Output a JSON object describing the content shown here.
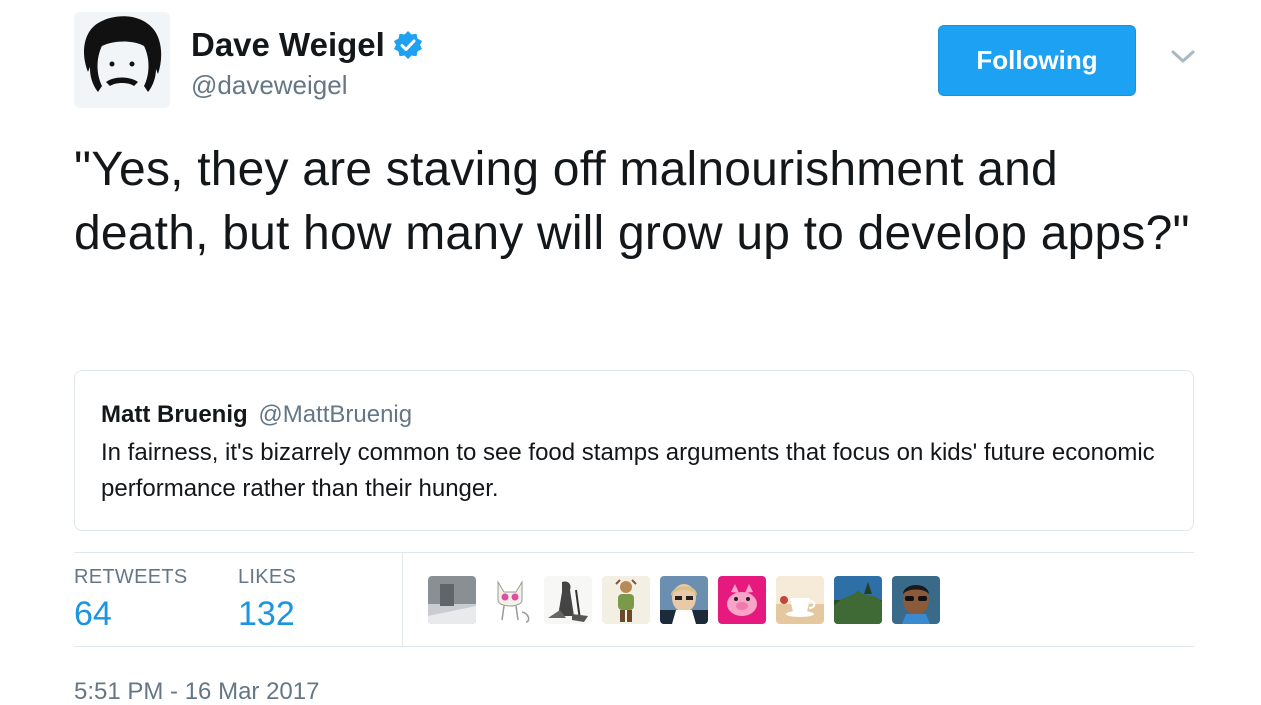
{
  "author": {
    "name": "Dave Weigel",
    "handle": "@daveweigel",
    "verified": true
  },
  "follow_button": {
    "label": "Following",
    "color": "#1da1f2"
  },
  "tweet": {
    "text": "\"Yes, they are staving off malnourishment and death, but how many will grow up to develop apps?\""
  },
  "quoted_tweet": {
    "name": "Matt Bruenig",
    "handle": "@MattBruenig",
    "text": "In fairness, it's bizarrely common to see food stamps arguments that focus on kids' future economic performance rather than their hunger."
  },
  "stats": {
    "retweets_label": "RETWEETS",
    "retweets_count": "64",
    "likes_label": "LIKES",
    "likes_count": "132"
  },
  "likers": [
    "liker-avatar-gray-photo",
    "liker-avatar-cartoon-cat",
    "liker-avatar-illustration",
    "liker-avatar-figure",
    "liker-avatar-woman-glasses",
    "liker-avatar-pink-pig",
    "liker-avatar-teacup",
    "liker-avatar-landscape",
    "liker-avatar-man-sunglasses"
  ],
  "timestamp": "5:51 PM - 16 Mar 2017",
  "colors": {
    "accent": "#1da1f2",
    "link": "#1b95e0",
    "muted": "#657786",
    "text": "#14171a"
  }
}
